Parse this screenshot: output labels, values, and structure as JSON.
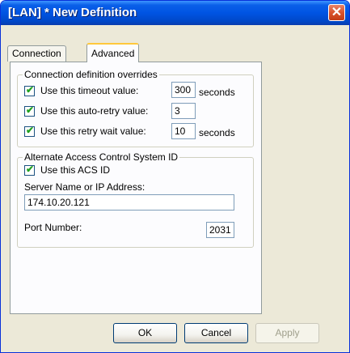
{
  "window": {
    "title": "[LAN] * New Definition",
    "close_glyph": "✕"
  },
  "tabs": [
    {
      "label": "Connection",
      "selected": false
    },
    {
      "label": "Advanced",
      "selected": true
    }
  ],
  "overrides": {
    "group_label": "Connection definition overrides",
    "items": [
      {
        "label": "Use this timeout value:",
        "checked": true,
        "value": "300",
        "units": "seconds"
      },
      {
        "label": "Use this auto-retry value:",
        "checked": true,
        "value": "3",
        "units": ""
      },
      {
        "label": "Use this retry wait value:",
        "checked": true,
        "value": "10",
        "units": "seconds"
      }
    ]
  },
  "acs": {
    "group_label": "Alternate Access Control System ID",
    "use_label": "Use this ACS ID",
    "use_checked": true,
    "server_label": "Server Name or IP Address:",
    "server_value": "174.10.20.121",
    "port_label": "Port Number:",
    "port_value": "2031"
  },
  "buttons": {
    "ok": "OK",
    "cancel": "Cancel",
    "apply": "Apply"
  },
  "check_glyph": "✔",
  "colors": {
    "title_bar": "#0054e3",
    "close_button": "#d9532c",
    "dialog_bg": "#ece9d8",
    "check_mark": "#21a121"
  }
}
